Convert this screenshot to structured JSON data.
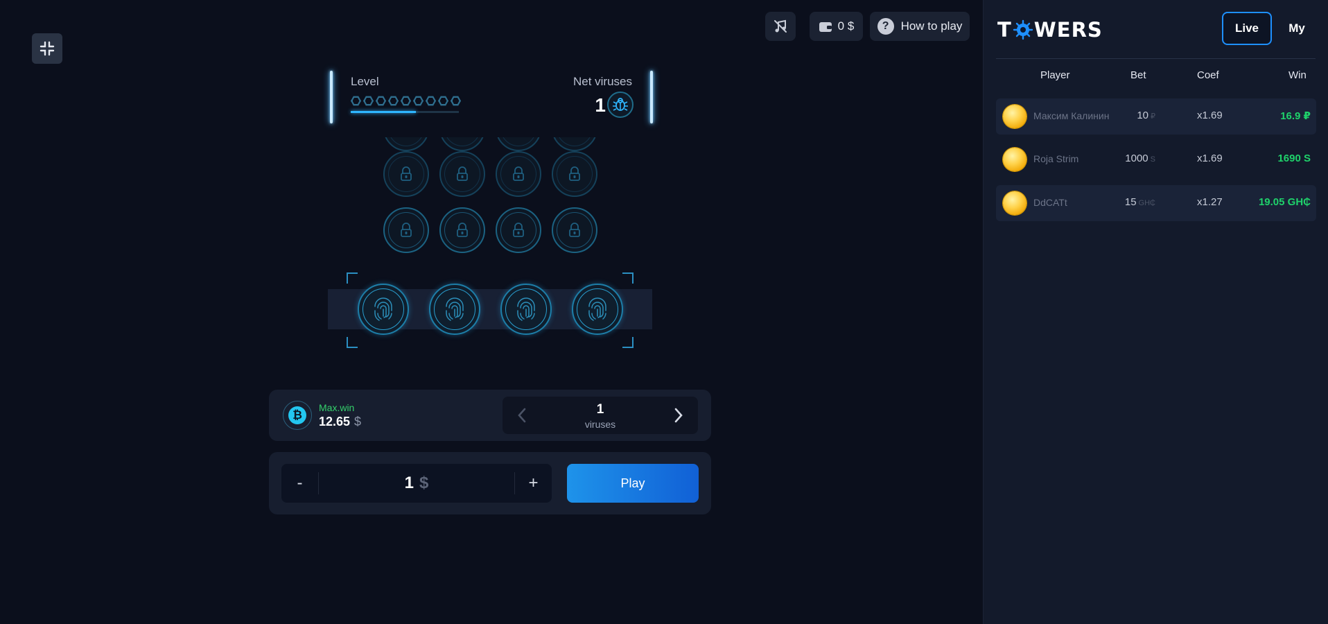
{
  "topbar": {
    "wallet_amount": "0 $",
    "how_to_play_label": "How to play"
  },
  "level": {
    "label": "Level",
    "total_levels": 9,
    "progress_fraction": 0.6
  },
  "net_viruses": {
    "label": "Net viruses",
    "value": "1"
  },
  "grid": {
    "locked_rows": 3,
    "columns": 4,
    "active_row_icon": "fingerprint-icon",
    "locked_icon": "lock-icon"
  },
  "info": {
    "maxwin_label": "Max.win",
    "maxwin_value": "12.65",
    "maxwin_currency": "$",
    "viruses_value": "1",
    "viruses_unit": "viruses"
  },
  "bet": {
    "minus_label": "-",
    "plus_label": "+",
    "value": "1",
    "currency": "$",
    "play_label": "Play"
  },
  "sidebar": {
    "brand": "TOWERS",
    "brand_prefix": "T",
    "brand_suffix": "WERS",
    "tab_live": "Live",
    "tab_my": "My",
    "headers": {
      "player": "Player",
      "bet": "Bet",
      "coef": "Coef",
      "win": "Win"
    },
    "rows": [
      {
        "player": "Максим Калинин",
        "bet": "10",
        "bet_cur": "₽",
        "coef": "x1.69",
        "win": "16.9 ₽"
      },
      {
        "player": "Roja Strim",
        "bet": "1000",
        "bet_cur": "S",
        "coef": "x1.69",
        "win": "1690 S"
      },
      {
        "player": "DdCATt",
        "bet": "15",
        "bet_cur": "GH₵",
        "coef": "x1.27",
        "win": "19.05 GH₵"
      }
    ]
  },
  "colors": {
    "accent": "#1e90ff",
    "win_green": "#1fd26b",
    "maxwin_green": "#34d06b",
    "glow_blue": "#2fb6ff"
  }
}
